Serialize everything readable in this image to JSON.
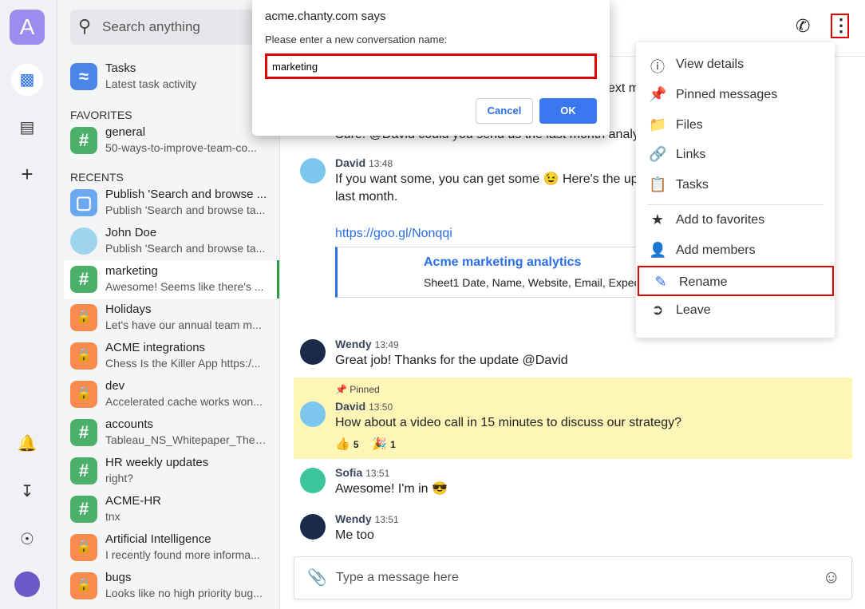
{
  "rail": {
    "avatar_letter": "A",
    "icons": [
      "chat-icon",
      "contacts-icon",
      "plus-icon",
      "bell-icon",
      "download-icon",
      "help-icon"
    ]
  },
  "sidebar": {
    "search_placeholder": "Search anything",
    "tasks": {
      "name": "Tasks",
      "sub": "Latest task activity"
    },
    "favorites_label": "FAVORITES",
    "favorites": [
      {
        "name": "general",
        "sub": "50-ways-to-improve-team-co..."
      }
    ],
    "recents_label": "RECENTS",
    "recents": [
      {
        "name": "Publish 'Search and browse ...",
        "sub": "Publish 'Search and browse ta...",
        "type": "task"
      },
      {
        "name": "John Doe",
        "sub": "Publish 'Search and browse ta...",
        "type": "user"
      },
      {
        "name": "marketing",
        "sub": "Awesome! Seems like there's ...",
        "type": "public",
        "selected": true
      },
      {
        "name": "Holidays",
        "sub": "Let's have our annual team m...",
        "type": "private"
      },
      {
        "name": "ACME integrations",
        "sub": "Chess Is the Killer App https:/...",
        "type": "private"
      },
      {
        "name": "dev",
        "sub": "Accelerated cache works won...",
        "type": "private"
      },
      {
        "name": "accounts",
        "sub": "Tableau_NS_Whitepaper_The_...",
        "type": "public"
      },
      {
        "name": "HR weekly updates",
        "sub": "right?",
        "type": "public"
      },
      {
        "name": "ACME-HR",
        "sub": "tnx",
        "type": "public"
      },
      {
        "name": "Artificial Intelligence",
        "sub": "I recently found more informa...",
        "type": "private"
      },
      {
        "name": "bugs",
        "sub": "Looks like no high priority bug...",
        "type": "private"
      }
    ]
  },
  "messages": {
    "partial1": "ext m",
    "partial2": "Sure. @David could you send us the last month analyt",
    "david1": {
      "author": "David",
      "time": "13:48",
      "text1": "If you want some, you can get some 😉 Here's the upd",
      "text2": "last month.",
      "link": "https://goo.gl/Nonqqi",
      "preview_title": "Acme marketing analytics",
      "preview_text": "Sheet1 Date, Name, Website, Email, Expecta"
    },
    "wendy1": {
      "author": "Wendy",
      "time": "13:49",
      "text": "Great job! Thanks for the update @David"
    },
    "pinned": {
      "label": "Pinned",
      "author": "David",
      "time": "13:50",
      "text": "How about a video call in 15 minutes to discuss our strategy?",
      "reactions": [
        {
          "emoji": "👍",
          "count": "5"
        },
        {
          "emoji": "🎉",
          "count": "1"
        }
      ]
    },
    "sofia": {
      "author": "Sofia",
      "time": "13:51",
      "text": "Awesome! I'm in 😎"
    },
    "wendy2": {
      "author": "Wendy",
      "time": "13:51",
      "text": "Me too"
    }
  },
  "composer": {
    "placeholder": "Type a message here"
  },
  "dialog": {
    "title": "acme.chanty.com says",
    "prompt": "Please enter a new conversation name:",
    "value": "marketing",
    "cancel": "Cancel",
    "ok": "OK"
  },
  "menu": {
    "items": [
      "View details",
      "Pinned messages",
      "Files",
      "Links",
      "Tasks",
      "Add to favorites",
      "Add members",
      "Rename",
      "Leave"
    ]
  },
  "colors": {
    "accent": "#2a6ee8",
    "highlight": "#e00000",
    "pinned_bg": "#fdf6b7"
  }
}
